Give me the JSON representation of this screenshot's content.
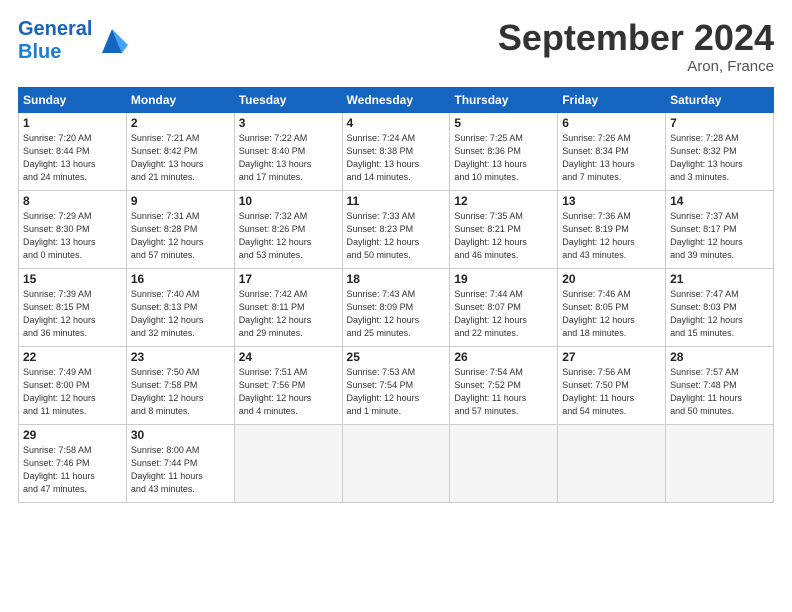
{
  "header": {
    "logo_general": "General",
    "logo_blue": "Blue",
    "title": "September 2024",
    "location": "Aron, France"
  },
  "columns": [
    "Sunday",
    "Monday",
    "Tuesday",
    "Wednesday",
    "Thursday",
    "Friday",
    "Saturday"
  ],
  "weeks": [
    [
      {
        "day": "1",
        "info": "Sunrise: 7:20 AM\nSunset: 8:44 PM\nDaylight: 13 hours\nand 24 minutes."
      },
      {
        "day": "2",
        "info": "Sunrise: 7:21 AM\nSunset: 8:42 PM\nDaylight: 13 hours\nand 21 minutes."
      },
      {
        "day": "3",
        "info": "Sunrise: 7:22 AM\nSunset: 8:40 PM\nDaylight: 13 hours\nand 17 minutes."
      },
      {
        "day": "4",
        "info": "Sunrise: 7:24 AM\nSunset: 8:38 PM\nDaylight: 13 hours\nand 14 minutes."
      },
      {
        "day": "5",
        "info": "Sunrise: 7:25 AM\nSunset: 8:36 PM\nDaylight: 13 hours\nand 10 minutes."
      },
      {
        "day": "6",
        "info": "Sunrise: 7:26 AM\nSunset: 8:34 PM\nDaylight: 13 hours\nand 7 minutes."
      },
      {
        "day": "7",
        "info": "Sunrise: 7:28 AM\nSunset: 8:32 PM\nDaylight: 13 hours\nand 3 minutes."
      }
    ],
    [
      {
        "day": "8",
        "info": "Sunrise: 7:29 AM\nSunset: 8:30 PM\nDaylight: 13 hours\nand 0 minutes."
      },
      {
        "day": "9",
        "info": "Sunrise: 7:31 AM\nSunset: 8:28 PM\nDaylight: 12 hours\nand 57 minutes."
      },
      {
        "day": "10",
        "info": "Sunrise: 7:32 AM\nSunset: 8:26 PM\nDaylight: 12 hours\nand 53 minutes."
      },
      {
        "day": "11",
        "info": "Sunrise: 7:33 AM\nSunset: 8:23 PM\nDaylight: 12 hours\nand 50 minutes."
      },
      {
        "day": "12",
        "info": "Sunrise: 7:35 AM\nSunset: 8:21 PM\nDaylight: 12 hours\nand 46 minutes."
      },
      {
        "day": "13",
        "info": "Sunrise: 7:36 AM\nSunset: 8:19 PM\nDaylight: 12 hours\nand 43 minutes."
      },
      {
        "day": "14",
        "info": "Sunrise: 7:37 AM\nSunset: 8:17 PM\nDaylight: 12 hours\nand 39 minutes."
      }
    ],
    [
      {
        "day": "15",
        "info": "Sunrise: 7:39 AM\nSunset: 8:15 PM\nDaylight: 12 hours\nand 36 minutes."
      },
      {
        "day": "16",
        "info": "Sunrise: 7:40 AM\nSunset: 8:13 PM\nDaylight: 12 hours\nand 32 minutes."
      },
      {
        "day": "17",
        "info": "Sunrise: 7:42 AM\nSunset: 8:11 PM\nDaylight: 12 hours\nand 29 minutes."
      },
      {
        "day": "18",
        "info": "Sunrise: 7:43 AM\nSunset: 8:09 PM\nDaylight: 12 hours\nand 25 minutes."
      },
      {
        "day": "19",
        "info": "Sunrise: 7:44 AM\nSunset: 8:07 PM\nDaylight: 12 hours\nand 22 minutes."
      },
      {
        "day": "20",
        "info": "Sunrise: 7:46 AM\nSunset: 8:05 PM\nDaylight: 12 hours\nand 18 minutes."
      },
      {
        "day": "21",
        "info": "Sunrise: 7:47 AM\nSunset: 8:03 PM\nDaylight: 12 hours\nand 15 minutes."
      }
    ],
    [
      {
        "day": "22",
        "info": "Sunrise: 7:49 AM\nSunset: 8:00 PM\nDaylight: 12 hours\nand 11 minutes."
      },
      {
        "day": "23",
        "info": "Sunrise: 7:50 AM\nSunset: 7:58 PM\nDaylight: 12 hours\nand 8 minutes."
      },
      {
        "day": "24",
        "info": "Sunrise: 7:51 AM\nSunset: 7:56 PM\nDaylight: 12 hours\nand 4 minutes."
      },
      {
        "day": "25",
        "info": "Sunrise: 7:53 AM\nSunset: 7:54 PM\nDaylight: 12 hours\nand 1 minute."
      },
      {
        "day": "26",
        "info": "Sunrise: 7:54 AM\nSunset: 7:52 PM\nDaylight: 11 hours\nand 57 minutes."
      },
      {
        "day": "27",
        "info": "Sunrise: 7:56 AM\nSunset: 7:50 PM\nDaylight: 11 hours\nand 54 minutes."
      },
      {
        "day": "28",
        "info": "Sunrise: 7:57 AM\nSunset: 7:48 PM\nDaylight: 11 hours\nand 50 minutes."
      }
    ],
    [
      {
        "day": "29",
        "info": "Sunrise: 7:58 AM\nSunset: 7:46 PM\nDaylight: 11 hours\nand 47 minutes."
      },
      {
        "day": "30",
        "info": "Sunrise: 8:00 AM\nSunset: 7:44 PM\nDaylight: 11 hours\nand 43 minutes."
      },
      null,
      null,
      null,
      null,
      null
    ]
  ]
}
